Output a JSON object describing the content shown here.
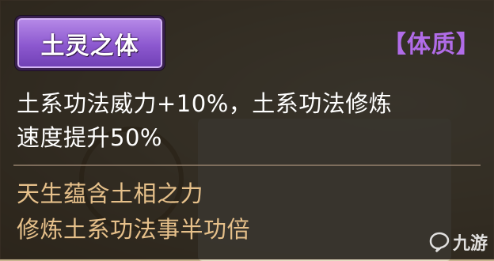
{
  "tooltip": {
    "name": "土灵之体",
    "category": "【体质】",
    "effect_line1": "土系功法威力+10%，土系功法修炼",
    "effect_line2": "速度提升50%",
    "lore_line1": "天生蕴含土相之力",
    "lore_line2": "修炼土系功法事半功倍"
  },
  "watermark": {
    "text": "九游",
    "icon": "jiuyou-logo-icon"
  },
  "colors": {
    "name_badge": "#8c58cf",
    "category": "#b16ce8",
    "effect_text": "#ffffff",
    "lore_text": "#e6c08a"
  }
}
